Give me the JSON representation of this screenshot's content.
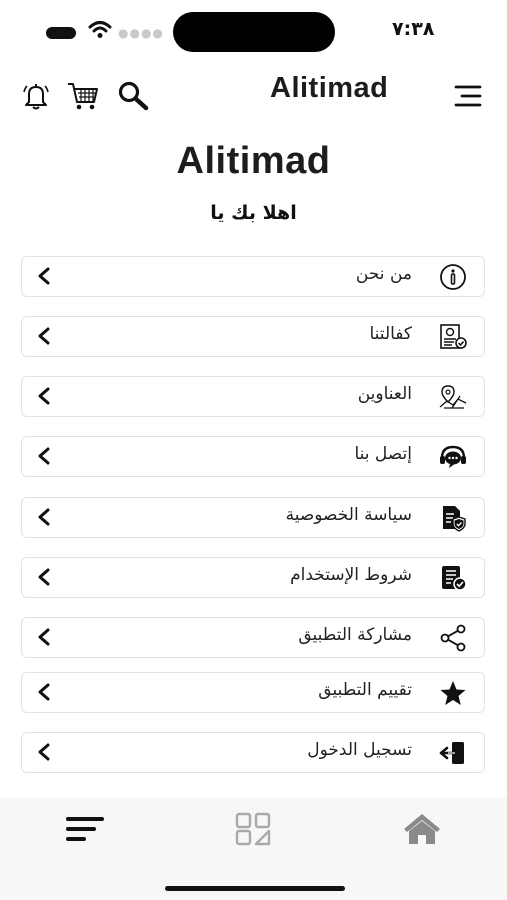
{
  "status": {
    "time": "٧:٣٨"
  },
  "appbar": {
    "title": "Alitimad"
  },
  "main": {
    "heading": "Alitimad",
    "welcome": "اهلا بك يا"
  },
  "menu": [
    {
      "label": "من نحن",
      "icon": "info-icon"
    },
    {
      "label": "كفالتنا",
      "icon": "certificate-icon"
    },
    {
      "label": "العناوين",
      "icon": "map-location-icon"
    },
    {
      "label": "إتصل بنا",
      "icon": "support-chat-icon"
    },
    {
      "label": "سياسة الخصوصية",
      "icon": "privacy-document-icon"
    },
    {
      "label": "شروط الإستخدام",
      "icon": "terms-document-icon"
    },
    {
      "label": "مشاركة التطبيق",
      "icon": "share-icon"
    },
    {
      "label": "تقييم التطبيق",
      "icon": "star-icon"
    },
    {
      "label": "تسجيل الدخول",
      "icon": "login-icon"
    }
  ],
  "bottom_nav": [
    {
      "name": "menu",
      "icon": "menu-lines-icon"
    },
    {
      "name": "categories",
      "icon": "grid-icon"
    },
    {
      "name": "home",
      "icon": "home-icon"
    }
  ]
}
